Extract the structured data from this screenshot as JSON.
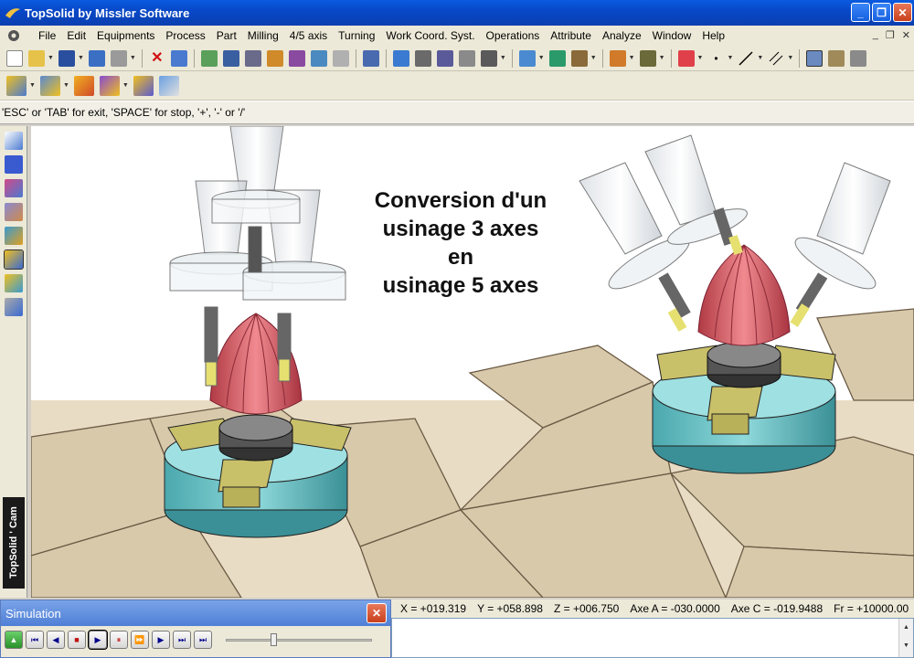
{
  "window": {
    "title": "TopSolid by Missler Software"
  },
  "menu": {
    "items": [
      "File",
      "Edit",
      "Equipments",
      "Process",
      "Part",
      "Milling",
      "4/5 axis",
      "Turning",
      "Work Coord. Syst.",
      "Operations",
      "Attribute",
      "Analyze",
      "Window",
      "Help"
    ]
  },
  "hint": {
    "text": "'ESC' or 'TAB' for exit, 'SPACE' for stop, '+', '-' or '/'"
  },
  "viewport": {
    "caption_line1": "Conversion d'un",
    "caption_line2": "usinage 3 axes",
    "caption_line3": "en",
    "caption_line4": "usinage 5 axes"
  },
  "sidebar": {
    "vertical_label": "TopSolid ' Cam"
  },
  "simulation": {
    "title": "Simulation",
    "close_label": "✕",
    "slider_fraction": 0.32
  },
  "coords": {
    "x": "X = +019.319",
    "y": "Y = +058.898",
    "z": "Z = +006.750",
    "a": "Axe A = -030.0000",
    "c": "Axe C = -019.9488",
    "fr": "Fr = +10000.00"
  },
  "colors": {
    "accent": "#0a5be0",
    "part": "#d9666b",
    "fixture": "#6fc1c4",
    "jaw": "#c9c06a",
    "table": "#d2c4a8"
  }
}
